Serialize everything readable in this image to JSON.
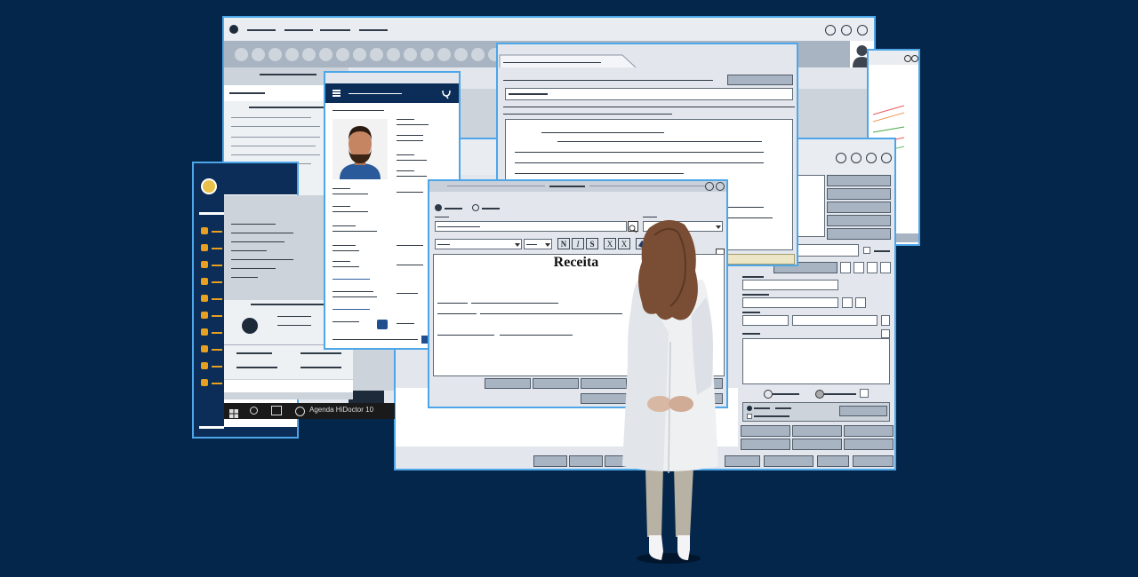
{
  "prescription": {
    "title": "Receita"
  },
  "taskbar": {
    "app_label": "Agenda HiDoctor 10"
  },
  "toolbar": {
    "format_buttons": [
      "N",
      "I",
      "S",
      "X",
      "X"
    ]
  },
  "colors": {
    "background": "#04264a",
    "window_border": "#4da6e8",
    "window_fill": "#e3e7ed",
    "sidebar_navy": "#0b2d57",
    "accent_orange": "#e8a020",
    "button_fill": "#a9b4c2"
  },
  "icons": {
    "sidebar": [
      "calendar-icon",
      "document-icon",
      "alert-icon",
      "pill-icon",
      "chart-icon",
      "flask-icon",
      "tag-icon",
      "money-icon",
      "clock-icon",
      "pie-icon"
    ]
  }
}
